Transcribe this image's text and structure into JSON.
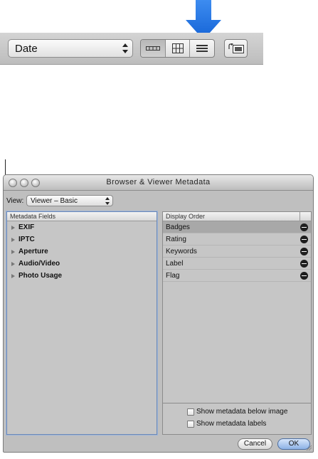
{
  "toolbar": {
    "sort_popup_label": "Date",
    "view_buttons": [
      "filmstrip-view",
      "grid-view",
      "list-view"
    ],
    "active_view": "list-view",
    "accent": "#1f6fe0"
  },
  "window": {
    "title": "Browser & Viewer Metadata",
    "view_label": "View:",
    "view_popup_value": "Viewer – Basic"
  },
  "metadata_fields": {
    "header": "Metadata Fields",
    "items": [
      "EXIF",
      "IPTC",
      "Aperture",
      "Audio/Video",
      "Photo Usage"
    ]
  },
  "display_order": {
    "header": "Display Order",
    "selected": "Badges",
    "items": [
      "Badges",
      "Rating",
      "Keywords",
      "Label",
      "Flag"
    ]
  },
  "options": {
    "below_image": "Show metadata below image",
    "labels": "Show metadata labels"
  },
  "buttons": {
    "cancel": "Cancel",
    "ok": "OK"
  }
}
